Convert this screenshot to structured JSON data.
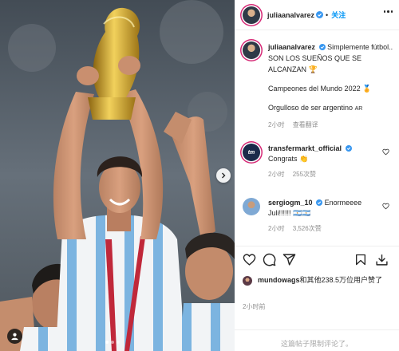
{
  "post": {
    "username": "juliaanalvarez",
    "follow_label": "关注",
    "separator": "•",
    "caption_line1": "Simplemente fútbol.. SON LOS SUEÑOS QUE SE ALCANZAN",
    "caption_line2": "Campeones del Mundo 2022",
    "caption_line3": "Orgulloso de ser argentino",
    "caption_emoji1": "🏆",
    "caption_emoji2": "🏅",
    "caption_flag": "AR",
    "caption_time": "2小时",
    "see_translation": "查看翻译"
  },
  "comments": [
    {
      "username": "transfermarkt_official",
      "text": "Congrats",
      "emoji": "👏",
      "time": "2小时",
      "likes": "255次赞",
      "avatar_text": "tm"
    },
    {
      "username": "sergiogm_10",
      "text": "Enormeeee Juli!!!!!!",
      "emoji": "🇦🇷🇦🇷",
      "time": "2小时",
      "likes": "3,526次赞"
    }
  ],
  "likes": {
    "liker": "mundowags",
    "rest": "和其他238.5万位用户赞了"
  },
  "post_time": "2小时前",
  "comments_limited": "这篇帖子限制评论了。",
  "carousel": {
    "count": 3,
    "active": 0
  },
  "colors": {
    "accent": "#0095f6",
    "verified": "#3897f0",
    "story_ring": "#d62976",
    "muted": "#8e8e8e"
  },
  "icons": [
    "heart-icon",
    "comment-icon",
    "share-icon",
    "bookmark-icon",
    "download-icon",
    "more-icon",
    "verified-icon",
    "chevron-right-icon",
    "person-tag-icon"
  ]
}
